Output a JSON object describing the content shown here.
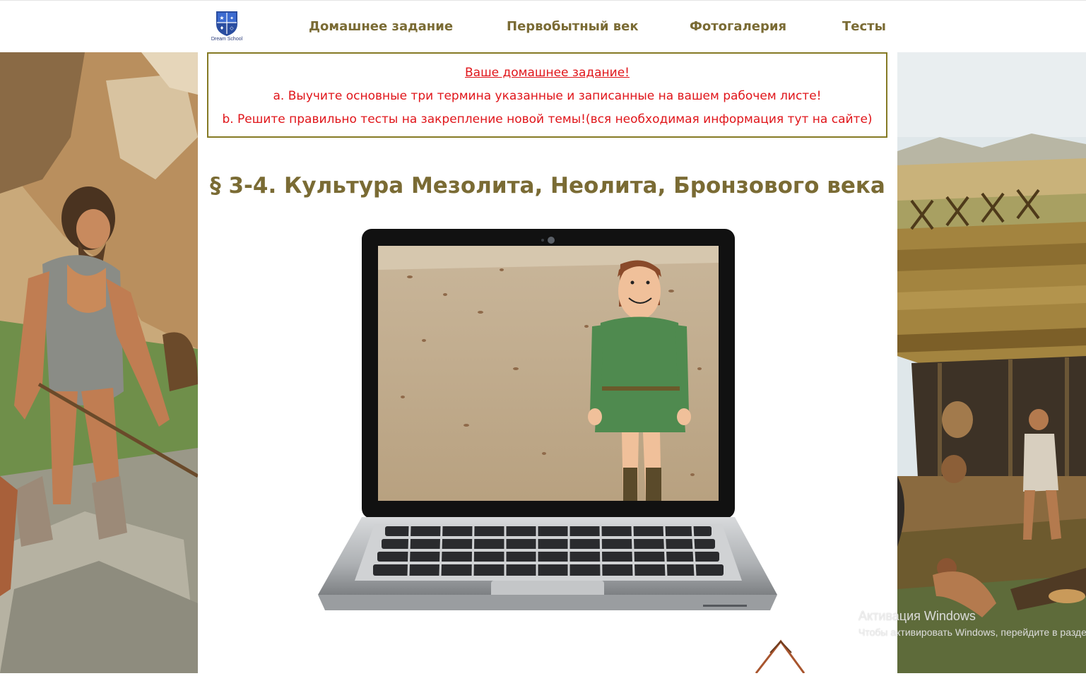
{
  "header": {
    "logo_text": "Dream School",
    "nav": [
      {
        "label": "Домашнее задание"
      },
      {
        "label": "Первобытный век"
      },
      {
        "label": "Фотогалерия"
      },
      {
        "label": "Тесты"
      }
    ]
  },
  "homework": {
    "title": "Ваше домашнее задание!",
    "item_a": "a. Выучите основные три термина указанные и записанные на вашем рабочем листе!",
    "item_b": "b. Решите правильно тесты на закрепление новой темы!(вся необходимая информация тут на сайте)"
  },
  "page_title": "§ 3-4. Культура Мезолита, Неолита, Бронзового века",
  "watermark": {
    "title": "Активация Windows",
    "subtitle": "Чтобы активировать Windows, перейдите в раздел..."
  },
  "colors": {
    "nav_text": "#7a6b34",
    "homework_text": "#e0151a",
    "homework_border": "#857a24"
  }
}
